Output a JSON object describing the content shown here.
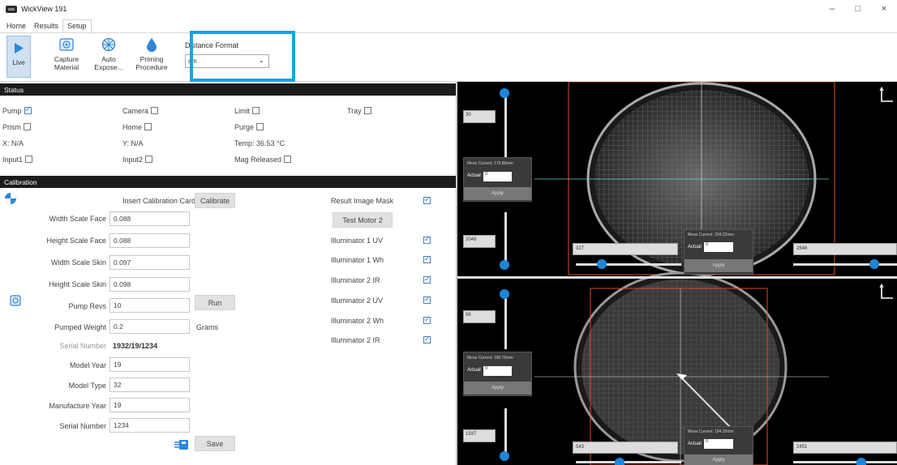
{
  "window": {
    "title": "WickView 191"
  },
  "window_controls": {
    "minimize": "–",
    "maximize": "□",
    "close": "×"
  },
  "menu": {
    "tabs": [
      "Home",
      "Results",
      "Setup"
    ]
  },
  "ribbon": {
    "live": "Live",
    "capture_1": "Capture",
    "capture_2": "Material",
    "auto_1": "Auto",
    "auto_2": "Expose...",
    "priming_1": "Priming",
    "priming_2": "Procedure",
    "distance_format_label": "Distance Format",
    "distance_format_value": "cm"
  },
  "status": {
    "header": "Status",
    "pump": "Pump",
    "camera": "Camera",
    "limit": "Limit",
    "tray": "Tray",
    "prism": "Prism",
    "home": "Home",
    "purge": "Purge",
    "x": "X: N/A",
    "y": "Y: N/A",
    "temp": "Temp: 36.53 °C",
    "input1": "Input1",
    "input2": "Input2",
    "mag_released": "Mag Released"
  },
  "calibration": {
    "header": "Calibration",
    "insert_card": "Insert Calibration Card",
    "calibrate": "Calibrate",
    "width_scale_face_label": "Width Scale Face",
    "width_scale_face": "0.088",
    "height_scale_face_label": "Height Scale Face",
    "height_scale_face": "0.088",
    "width_scale_skin_label": "Width Scale Skin",
    "width_scale_skin": "0.097",
    "height_scale_skin_label": "Height Scale Skin",
    "height_scale_skin": "0.098",
    "pump_revs_label": "Pump Revs",
    "pump_revs": "10",
    "run": "Run",
    "pumped_weight_label": "Pumped Weight",
    "pumped_weight": "0.2",
    "grams": "Grams",
    "serial_label": "Serial Number",
    "serial_value": "1932/19/1234",
    "model_year_label": "Model Year",
    "model_year": "19",
    "model_type_label": "Model Type",
    "model_type": "32",
    "manufacture_year_label": "Manufacture Year",
    "manufacture_year": "19",
    "serial_number_label": "Serial Number",
    "serial_number": "1234",
    "save": "Save",
    "result_image_mask": "Result Image Mask",
    "test_motor": "Test Motor 2",
    "illuminators": [
      "Illuminator 1 UV",
      "Illuminator 1 Wh",
      "Illuminator 2 IR",
      "Illuminator 2 UV",
      "Illuminator 2 Wh",
      "Illuminator 2 IR"
    ]
  },
  "camera_top": {
    "v_slider_top": "30",
    "v_slider_bottom": "2048",
    "meas_left": "Meas Current: 176.86mm",
    "actual_label": "Actual",
    "actual_left": "0",
    "apply": "Apply",
    "meas_center": "Meas Current: 204.32mm",
    "actual_center": "0",
    "h_left": "327",
    "h_right": "2646"
  },
  "camera_bottom": {
    "v_slider_top": "86",
    "v_slider_bottom": "1937",
    "meas_left": "Meas Current: 180.76mm",
    "actual_label": "Actual",
    "actual_left": "0",
    "apply": "Apply",
    "meas_center": "Meas Current: 184.35mm",
    "actual_center": "0",
    "h_left": "543",
    "h_right": "2451"
  }
}
